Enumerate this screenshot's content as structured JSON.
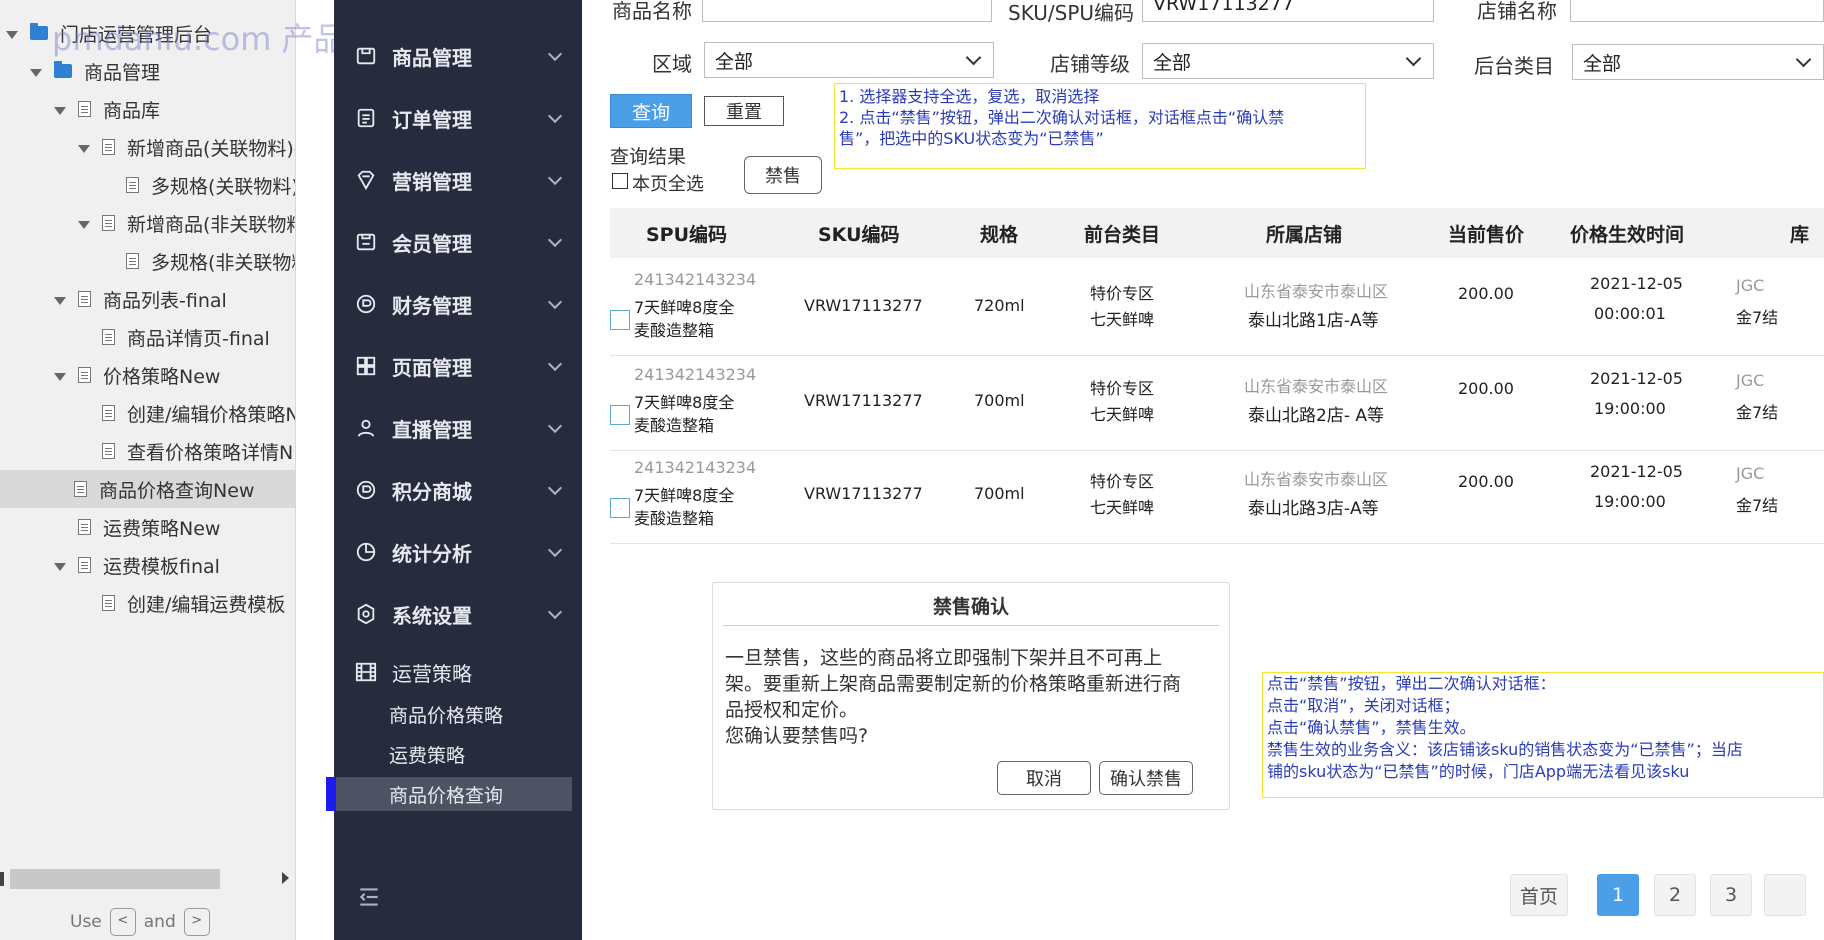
{
  "watermark": "pmdaniu.com 产品原型素材网站",
  "tree": {
    "items": [
      {
        "label": "门店运营管理后台",
        "type": "folder",
        "caret": true
      },
      {
        "label": "商品管理",
        "type": "folder",
        "caret": true
      },
      {
        "label": "商品库",
        "type": "page",
        "caret": true
      },
      {
        "label": "新增商品(关联物料)-",
        "type": "page",
        "caret": true
      },
      {
        "label": "多规格(关联物料)",
        "type": "page",
        "caret": false
      },
      {
        "label": "新增商品(非关联物料",
        "type": "page",
        "caret": true
      },
      {
        "label": "多规格(非关联物料",
        "type": "page",
        "caret": false
      },
      {
        "label": "商品列表-final",
        "type": "page",
        "caret": true
      },
      {
        "label": "商品详情页-final",
        "type": "page",
        "caret": false
      },
      {
        "label": "价格策略New",
        "type": "page",
        "caret": true
      },
      {
        "label": "创建/编辑价格策略N",
        "type": "page",
        "caret": false
      },
      {
        "label": "查看价格策略详情N",
        "type": "page",
        "caret": false
      },
      {
        "label": "商品价格查询New",
        "type": "page",
        "caret": false,
        "selected": true
      },
      {
        "label": "运费策略New",
        "type": "page",
        "caret": false
      },
      {
        "label": "运费模板final",
        "type": "page",
        "caret": true
      },
      {
        "label": "创建/编辑运费模板",
        "type": "page",
        "caret": false
      }
    ],
    "hint_use": "Use",
    "hint_and": "and",
    "key_prev": "<\n,",
    "key_next": ">\n."
  },
  "sidebar": {
    "menus": [
      {
        "label": "商品管理",
        "icon": "product-icon"
      },
      {
        "label": "订单管理",
        "icon": "order-icon"
      },
      {
        "label": "营销管理",
        "icon": "marketing-icon"
      },
      {
        "label": "会员管理",
        "icon": "member-icon"
      },
      {
        "label": "财务管理",
        "icon": "finance-icon"
      },
      {
        "label": "页面管理",
        "icon": "page-grid-icon"
      },
      {
        "label": "直播管理",
        "icon": "user-icon"
      },
      {
        "label": "积分商城",
        "icon": "points-icon"
      },
      {
        "label": "统计分析",
        "icon": "pie-chart-icon"
      },
      {
        "label": "系统设置",
        "icon": "settings-icon"
      }
    ],
    "ops_group": "运营策略",
    "sub_items": [
      "商品价格策略",
      "运费策略",
      "商品价格查询"
    ]
  },
  "filters": {
    "product_name_label": "商品名称",
    "product_name_value": "",
    "sku_label": "SKU/SPU编码",
    "sku_value": "VRW17113277",
    "store_name_label": "店铺名称",
    "store_name_value": "",
    "region_label": "区域",
    "region_value": "全部",
    "store_level_label": "店铺等级",
    "store_level_value": "全部",
    "category_label": "后台类目",
    "category_value": "全部"
  },
  "actions": {
    "query": "查询",
    "reset": "重置",
    "results_label": "查询结果",
    "select_all": "本页全选",
    "ban": "禁售"
  },
  "note_top": {
    "line1": "1. 选择器支持全选，复选，取消选择",
    "line2": "2. 点击“禁售”按钮，弹出二次确认对话框，对话框点击“确认禁",
    "line3": "售”，把选中的SKU状态变为“已禁售”"
  },
  "table": {
    "headers": [
      "SPU编码",
      "SKU编码",
      "规格",
      "前台类目",
      "所属店铺",
      "当前售价",
      "价格生效时间",
      "库"
    ],
    "rows": [
      {
        "spu": "241342143234",
        "name1": "7天鲜啤8度全",
        "name2": "麦酸造整箱",
        "sku": "VRW17113277",
        "spec": "720ml",
        "cat1": "特价专区",
        "cat2": "七天鲜啤",
        "region": "山东省泰安市泰山区",
        "store": "泰山北路1店-A等",
        "price": "200.00",
        "date": "2021-12-05",
        "time": "00:00:01",
        "extra1": "JGC",
        "extra2": "金7结"
      },
      {
        "spu": "241342143234",
        "name1": "7天鲜啤8度全",
        "name2": "麦酸造整箱",
        "sku": "VRW17113277",
        "spec": "700ml",
        "cat1": "特价专区",
        "cat2": "七天鲜啤",
        "region": "山东省泰安市泰山区",
        "store": "泰山北路2店- A等",
        "price": "200.00",
        "date": "2021-12-05",
        "time": "19:00:00",
        "extra1": "JGC",
        "extra2": "金7结"
      },
      {
        "spu": "241342143234",
        "name1": "7天鲜啤8度全",
        "name2": "麦酸造整箱",
        "sku": "VRW17113277",
        "spec": "700ml",
        "cat1": "特价专区",
        "cat2": "七天鲜啤",
        "region": "山东省泰安市泰山区",
        "store": "泰山北路3店-A等",
        "price": "200.00",
        "date": "2021-12-05",
        "time": "19:00:00",
        "extra1": "JGC",
        "extra2": "金7结"
      }
    ]
  },
  "dialog": {
    "title": "禁售确认",
    "line1": "一旦禁售，这些的商品将立即强制下架并且不可再上",
    "line2": "架。要重新上架商品需要制定新的价格策略重新进行商",
    "line3": "品授权和定价。",
    "line4": "您确认要禁售吗?",
    "cancel": "取消",
    "confirm": "确认禁售"
  },
  "note_bottom": {
    "line1": "点击“禁售”按钮，弹出二次确认对话框：",
    "line2": "点击“取消”，关闭对话框；",
    "line3": "点击“确认禁售”，禁售生效。",
    "line4": "禁售生效的业务含义：该店铺该sku的销售状态变为“已禁售”；当店",
    "line5": "铺的sku状态为“已禁售”的时候，门店App端无法看见该sku"
  },
  "pagination": {
    "first": "首页",
    "pages": [
      "1",
      "2",
      "3"
    ],
    "current": "1"
  },
  "colors": {
    "sidebar_bg": "#262b3d",
    "primary": "#4a9fe6",
    "note_border": "#f2e534",
    "note_text": "#2b3cb9"
  }
}
